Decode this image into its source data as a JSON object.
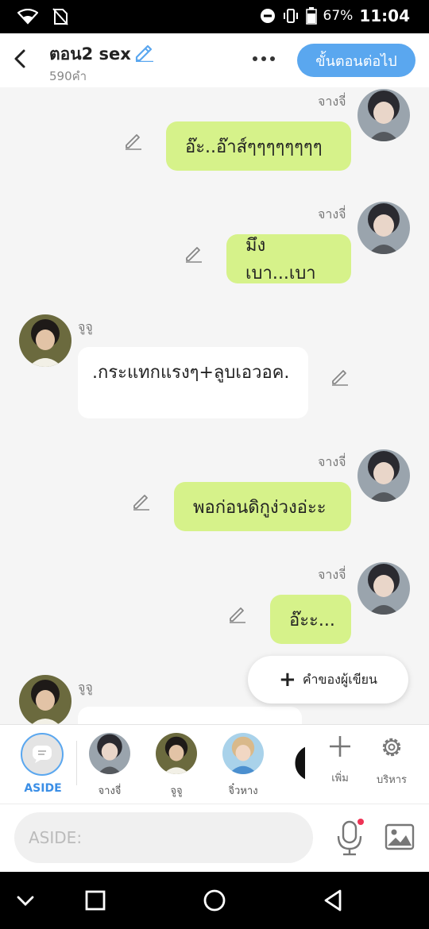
{
  "status": {
    "battery": "67%",
    "time": "11:04"
  },
  "header": {
    "title": "ตอน2 sex",
    "word_count": "590คำ",
    "next_label": "ขั้นตอนต่อไป"
  },
  "messages": [
    {
      "sender": "จางจี่",
      "text": "อ๊ะ..อ๊าส์ๆๆๆๆๆๆๆๆ",
      "side": "right"
    },
    {
      "sender": "จางจี่",
      "text": "มึงเบา...เบา",
      "side": "right"
    },
    {
      "sender": "จูจู",
      "text": ".กระแทกแรงๆ+ลูบเอวอค.",
      "side": "left"
    },
    {
      "sender": "จางจี่",
      "text": "พอก่อนดิกูง่วงอ่ะะ",
      "side": "right"
    },
    {
      "sender": "จางจี่",
      "text": "อ๊ะะ...",
      "side": "right"
    },
    {
      "sender": "จูจู",
      "text": "",
      "side": "left"
    }
  ],
  "author_button": "คำของผู้เขียน",
  "charbar": {
    "aside_label": "ASIDE",
    "characters": [
      "จางจี่",
      "จูจู",
      "จิ๋วหาง"
    ],
    "add_label": "เพิ่ม",
    "manage_label": "บริหาร"
  },
  "input": {
    "placeholder": "ASIDE:"
  },
  "colors": {
    "accent": "#5aa7ef",
    "bubble_green": "#d6f28a"
  }
}
